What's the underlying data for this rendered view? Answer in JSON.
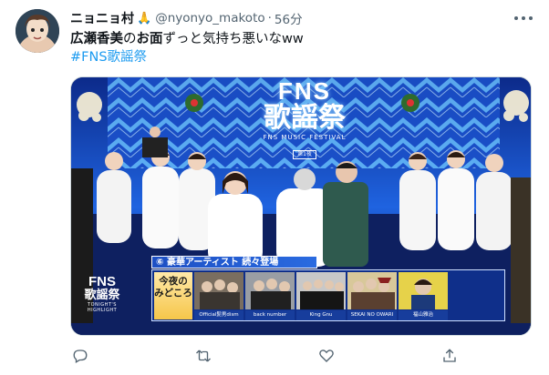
{
  "tweet": {
    "display_name": "ニョニョ村",
    "name_emoji": "🙏",
    "handle": "@nyonyo_makoto",
    "separator": "·",
    "time": "56分",
    "text_bold": "広瀬香美",
    "text_mid": "の",
    "text_bold2": "お面",
    "text_rest": "ずっと気持ち悪いなww",
    "hashtag": "#FNS歌謡祭"
  },
  "media": {
    "logo_fns": "FNS",
    "logo_kayo": "歌謡祭",
    "logo_festival": "FNS MUSIC FESTIVAL",
    "logo_sub": "第1夜",
    "banner": "⑥ 豪華アーティスト 続々登場",
    "tonight_label_line1": "今夜の",
    "tonight_label_line2": "みどころ",
    "corner_fns": "FNS",
    "corner_kayo": "歌謡祭",
    "corner_tonight": "TONIGHT'S HIGHLIGHT",
    "highlights": [
      {
        "name": "Official髭男dism"
      },
      {
        "name": "back number"
      },
      {
        "name": "King Gnu"
      },
      {
        "name": "SEKAI NO OWARI"
      },
      {
        "name": "福山雅治"
      }
    ]
  },
  "actions": {
    "icons": [
      "reply-icon",
      "retweet-icon",
      "like-icon",
      "share-icon"
    ]
  },
  "colors": {
    "link": "#1d9bf0",
    "muted": "#536471",
    "text": "#0f1419",
    "stage_blue": "#1b5fd6"
  }
}
